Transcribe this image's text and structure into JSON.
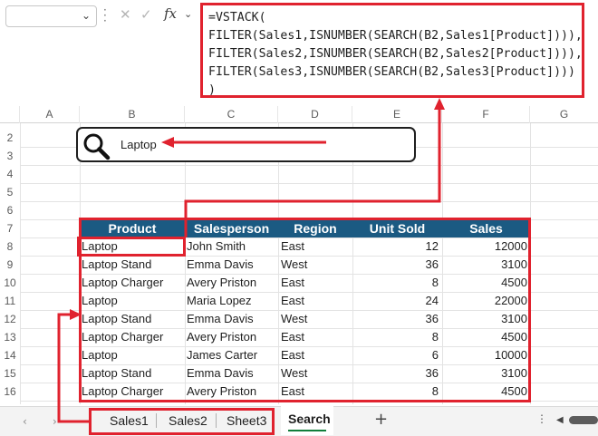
{
  "formula_bar": {
    "name_box_value": "",
    "fx_label": "fx",
    "formula_lines": [
      "=VSTACK(",
      "FILTER(Sales1,ISNUMBER(SEARCH(B2,Sales1[Product]))),",
      "FILTER(Sales2,ISNUMBER(SEARCH(B2,Sales2[Product]))),",
      "FILTER(Sales3,ISNUMBER(SEARCH(B2,Sales3[Product])))",
      ")"
    ]
  },
  "columns": [
    "A",
    "B",
    "C",
    "D",
    "E",
    "F",
    "G"
  ],
  "rows": [
    "2",
    "3",
    "4",
    "5",
    "6",
    "7",
    "8",
    "9",
    "10",
    "11",
    "12",
    "13",
    "14",
    "15",
    "16"
  ],
  "search": {
    "value": "Laptop",
    "icon": "search-icon"
  },
  "table": {
    "headers": [
      "Product",
      "Salesperson",
      "Region",
      "Unit Sold",
      "Sales"
    ],
    "rows": [
      [
        "Laptop",
        "John Smith",
        "East",
        "12",
        "12000"
      ],
      [
        "Laptop Stand",
        "Emma Davis",
        "West",
        "36",
        "3100"
      ],
      [
        "Laptop Charger",
        "Avery Priston",
        "East",
        "8",
        "4500"
      ],
      [
        "Laptop",
        "Maria Lopez",
        "East",
        "24",
        "22000"
      ],
      [
        "Laptop Stand",
        "Emma Davis",
        "West",
        "36",
        "3100"
      ],
      [
        "Laptop Charger",
        "Avery Priston",
        "East",
        "8",
        "4500"
      ],
      [
        "Laptop",
        "James Carter",
        "East",
        "6",
        "10000"
      ],
      [
        "Laptop Stand",
        "Emma Davis",
        "West",
        "36",
        "3100"
      ],
      [
        "Laptop Charger",
        "Avery Priston",
        "East",
        "8",
        "4500"
      ]
    ]
  },
  "sheet_tabs": {
    "tabs": [
      "Sales1",
      "Sales2",
      "Sheet3"
    ],
    "active": "Search",
    "add": "+"
  },
  "colors": {
    "highlight_red": "#e0222e",
    "header_fill": "#1b5a82",
    "active_tab_underline": "#117e3b"
  }
}
